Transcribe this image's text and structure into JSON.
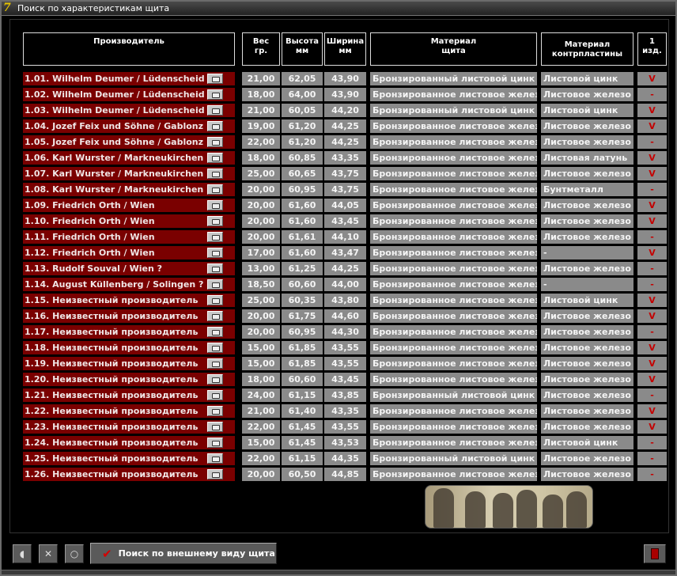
{
  "window": {
    "title": "Поиск по характеристикам щита"
  },
  "headers": {
    "maker": "Производитель",
    "weight": "Вес\nгр.",
    "height": "Высота\nмм",
    "width": "Ширина\nмм",
    "material": "Материал\nщита",
    "backplate": "Материал\nконтрпластины",
    "sample": "1 изд."
  },
  "rows": [
    {
      "maker": "1.01. Wilhelm Deumer / Lüdenscheid",
      "weight": "21,00",
      "height": "62,05",
      "width": "43,90",
      "material": "Бронзированный листовой цинк",
      "backplate": "Листовой цинк",
      "flag": "V"
    },
    {
      "maker": "1.02. Wilhelm Deumer / Lüdenscheid",
      "weight": "18,00",
      "height": "64,00",
      "width": "43,90",
      "material": "Бронзированное листовое железо",
      "backplate": "Листовое железо",
      "flag": "-"
    },
    {
      "maker": "1.03. Wilhelm Deumer / Lüdenscheid",
      "weight": "21,00",
      "height": "60,05",
      "width": "44,20",
      "material": "Бронзированный  листовой цинк",
      "backplate": "Листовой цинк",
      "flag": "V"
    },
    {
      "maker": "1.04. Jozef Feix und Söhne / Gablonz",
      "weight": "19,00",
      "height": "61,20",
      "width": "44,25",
      "material": "Бронзированное листовое железо",
      "backplate": "Листовое железо",
      "flag": "V"
    },
    {
      "maker": "1.05. Jozef Feix und Söhne / Gablonz",
      "weight": "22,00",
      "height": "61,20",
      "width": "44,25",
      "material": "Бронзированное листовое железо",
      "backplate": "Листовое железо",
      "flag": "-"
    },
    {
      "maker": "1.06. Karl Wurster / Markneukirchen",
      "weight": "18,00",
      "height": "60,85",
      "width": "43,35",
      "material": "Бронзированное листовое железо",
      "backplate": "Листовая латунь",
      "flag": "V"
    },
    {
      "maker": "1.07. Karl Wurster / Markneukirchen",
      "weight": "25,00",
      "height": "60,65",
      "width": "43,75",
      "material": "Бронзированное листовое железо",
      "backplate": "Листовое железо",
      "flag": "V"
    },
    {
      "maker": "1.08. Karl Wurster / Markneukirchen",
      "weight": "20,00",
      "height": "60,95",
      "width": "43,75",
      "material": "Бронзированное листовое железо",
      "backplate": "Бунтметалл",
      "flag": "-"
    },
    {
      "maker": "1.09. Friedrich Orth / Wien",
      "weight": "20,00",
      "height": "61,60",
      "width": "44,05",
      "material": "Бронзированное листовое железо",
      "backplate": "Листовое железо",
      "flag": "V"
    },
    {
      "maker": "1.10. Friedrich Orth / Wien",
      "weight": "20,00",
      "height": "61,60",
      "width": "43,45",
      "material": "Бронзированное листовое железо",
      "backplate": "Листовое железо",
      "flag": "V"
    },
    {
      "maker": "1.11. Friedrich Orth / Wien",
      "weight": "20,00",
      "height": "61,61",
      "width": "44,10",
      "material": "Бронзированное листовое железо",
      "backplate": "Листовое железо",
      "flag": "-"
    },
    {
      "maker": "1.12. Friedrich Orth / Wien",
      "weight": "17,00",
      "height": "61,60",
      "width": "43,47",
      "material": "Бронзированное листовое железо",
      "backplate": "-",
      "flag": "V"
    },
    {
      "maker": "1.13. Rudolf Souval / Wien ?",
      "weight": "13,00",
      "height": "61,25",
      "width": "44,25",
      "material": "Бронзированное листовое железо",
      "backplate": "Листовое железо",
      "flag": "-"
    },
    {
      "maker": "1.14. August Küllenberg / Solingen ?",
      "weight": "18,50",
      "height": "60,60",
      "width": "44,00",
      "material": "Бронзированное листовое железо",
      "backplate": "-",
      "flag": "-"
    },
    {
      "maker": "1.15. Неизвестный производитель",
      "weight": "25,00",
      "height": "60,35",
      "width": "43,80",
      "material": "Бронзированное листовое железо",
      "backplate": "Листовой цинк",
      "flag": "V"
    },
    {
      "maker": "1.16. Неизвестный производитель",
      "weight": "20,00",
      "height": "61,75",
      "width": "44,60",
      "material": "Бронзированное листовое железо",
      "backplate": "Листовое железо",
      "flag": "V"
    },
    {
      "maker": "1.17. Неизвестный производитель",
      "weight": "20,00",
      "height": "60,95",
      "width": "44,30",
      "material": "Бронзированное листовое железо",
      "backplate": "Листовое железо",
      "flag": "-"
    },
    {
      "maker": "1.18. Неизвестный производитель",
      "weight": "15,00",
      "height": "61,85",
      "width": "43,55",
      "material": "Бронзированное листовое железо",
      "backplate": "Листовое железо",
      "flag": "V"
    },
    {
      "maker": "1.19. Неизвестный производитель",
      "weight": "15,00",
      "height": "61,85",
      "width": "43,55",
      "material": "Бронзированное листовое железо",
      "backplate": "Листовое железо",
      "flag": "V"
    },
    {
      "maker": "1.20. Неизвестный производитель",
      "weight": "18,00",
      "height": "60,60",
      "width": "43,45",
      "material": "Бронзированное листовое железо",
      "backplate": "Листовое железо",
      "flag": "V"
    },
    {
      "maker": "1.21. Неизвестный производитель",
      "weight": "24,00",
      "height": "61,15",
      "width": "43,85",
      "material": "Бронзированный листовой цинк",
      "backplate": "Листовое железо",
      "flag": "-"
    },
    {
      "maker": "1.22. Неизвестный производитель",
      "weight": "21,00",
      "height": "61,40",
      "width": "43,35",
      "material": "Бронзированное листовое железо",
      "backplate": "Листовое железо",
      "flag": "V"
    },
    {
      "maker": "1.23. Неизвестный производитель",
      "weight": "22,00",
      "height": "61,45",
      "width": "43,55",
      "material": "Бронзированное листовое железо",
      "backplate": "Листовое железо",
      "flag": "V"
    },
    {
      "maker": "1.24. Неизвестный производитель",
      "weight": "15,00",
      "height": "61,45",
      "width": "43,53",
      "material": "Бронзированное листовое железо",
      "backplate": "Листовой цинк",
      "flag": "-"
    },
    {
      "maker": "1.25. Неизвестный производитель",
      "weight": "22,00",
      "height": "61,15",
      "width": "44,35",
      "material": "Бронзированный листовой цинк",
      "backplate": "Листовое железо",
      "flag": "-"
    },
    {
      "maker": "1.26. Неизвестный производитель",
      "weight": "20,00",
      "height": "60,50",
      "width": "44,85",
      "material": "Бронзированное листовое железо",
      "backplate": "Листовое железо",
      "flag": "-"
    }
  ],
  "footer": {
    "search_label": "Поиск по внешнему виду щита",
    "icons": [
      "speaker-icon",
      "tools-icon",
      "magnifier-icon",
      "exit-door-icon"
    ]
  },
  "colors": {
    "maker_bg": "#7a0000",
    "cell_bg": "#8a8a8a",
    "flag": "#c40000",
    "background": "#000000"
  }
}
